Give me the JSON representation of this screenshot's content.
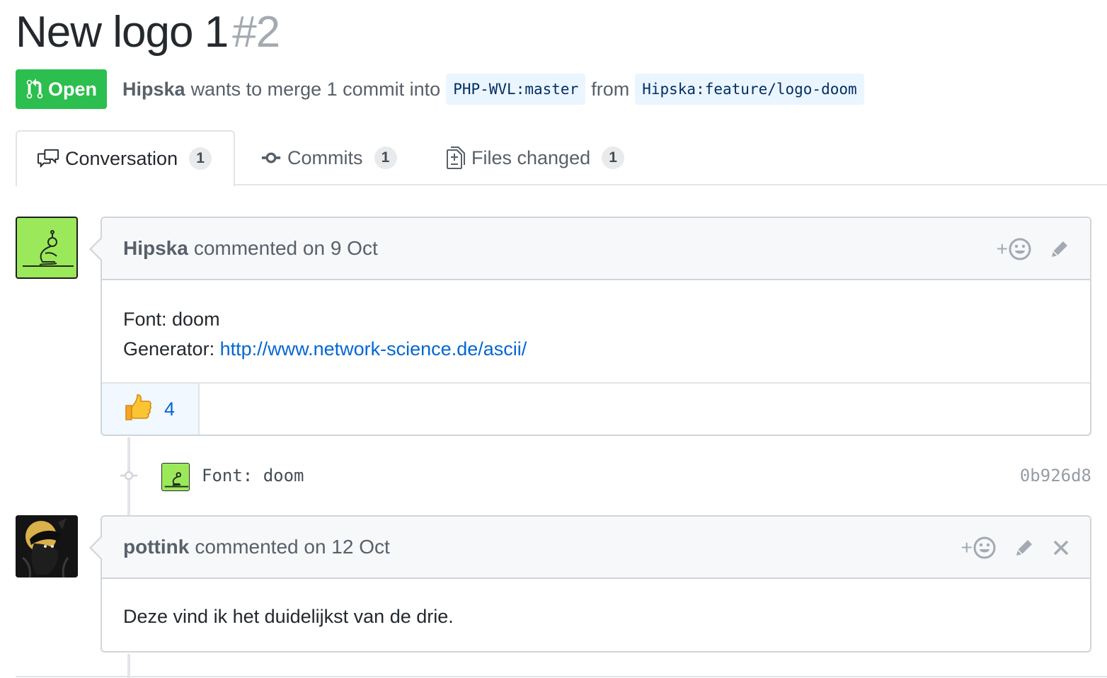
{
  "pr": {
    "title": "New logo 1",
    "number": "#2",
    "state": "Open",
    "author": "Hipska",
    "merge_text": "wants to merge 1 commit into",
    "base_ref": "PHP-WVL:master",
    "from_word": "from",
    "head_ref": "Hipska:feature/logo-doom"
  },
  "tabs": [
    {
      "label": "Conversation",
      "count": "1",
      "icon": "comment-discussion-icon"
    },
    {
      "label": "Commits",
      "count": "1",
      "icon": "git-commit-icon"
    },
    {
      "label": "Files changed",
      "count": "1",
      "icon": "file-diff-icon"
    }
  ],
  "comments": [
    {
      "author": "Hipska",
      "action": "commented on 9 Oct",
      "body_line1": "Font: doom",
      "body_line2_prefix": "Generator: ",
      "body_link": "http://www.network-science.de/ascii/",
      "reaction_emoji": "👍",
      "reaction_count": "4"
    },
    {
      "author": "pottink",
      "action": "commented on 12 Oct",
      "body_line1": "Deze vind ik het duidelijkst van de drie."
    }
  ],
  "commit": {
    "message": "Font: doom",
    "sha": "0b926d8"
  },
  "colors": {
    "open_green": "#2cbe4e",
    "link_blue": "#0366d6",
    "avatar_green": "#9be95b"
  }
}
